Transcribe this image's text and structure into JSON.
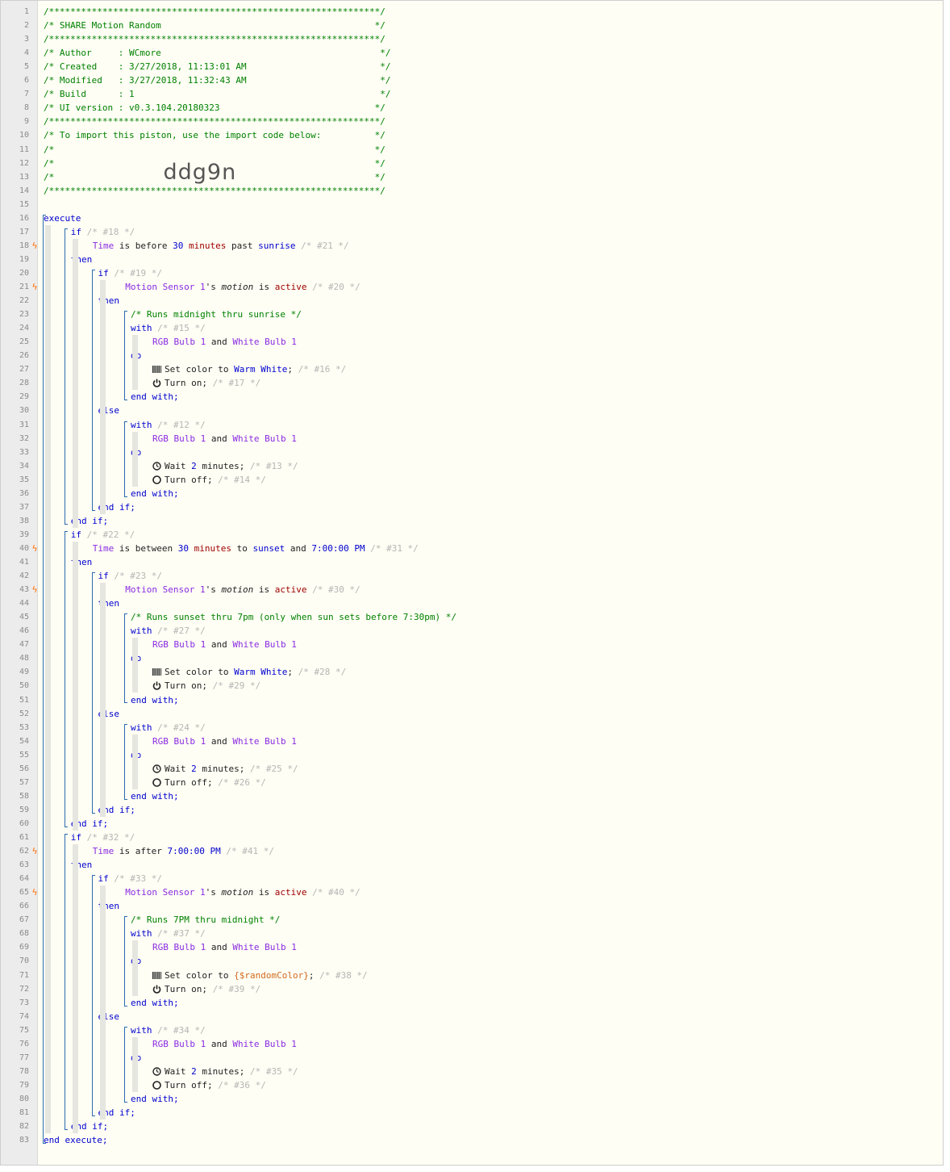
{
  "header": {
    "border_line": "/**************************************************************/",
    "share_line": "/* SHARE Motion Random                                        */",
    "author_line": "/* Author     : WCmore                                         */",
    "created_line": "/* Created    : 3/27/2018, 11:13:01 AM                         */",
    "modified_line": "/* Modified   : 3/27/2018, 11:32:43 AM                         */",
    "build_line": "/* Build      : 1                                              */",
    "ui_line": "/* UI version : v0.3.104.20180323                             */",
    "import_line": "/* To import this piston, use the import code below:          */",
    "blank_line": "/*                                                            */",
    "import_code": "ddg9n"
  },
  "code": {
    "execute": "execute",
    "end_execute": "end execute;",
    "if": "if",
    "then": "then",
    "else": "else",
    "end_if": "end if;",
    "with": "with",
    "do": "do",
    "end_with": "end with;",
    "and": "and",
    "time": "Time",
    "is_before": "is before",
    "past": "past",
    "sunrise": "sunrise",
    "is_between": "is between",
    "to": "to",
    "sunset": "sunset",
    "is_after": "is after",
    "minutes_30": "30",
    "minutes_unit": "minutes",
    "time_7pm": "7:00:00 PM",
    "motion_sensor": "Motion Sensor 1",
    "apos_s": "'s",
    "motion_attr": "motion",
    "is": "is",
    "active": "active",
    "rgb_bulb": "RGB Bulb 1",
    "white_bulb": "White Bulb 1",
    "set_color_to": "Set color to",
    "warm_white": "Warm White",
    "random_color": "{$randomColor}",
    "semicolon": ";",
    "turn_on": "Turn on;",
    "turn_off": "Turn off;",
    "wait": "Wait",
    "wait_num": "2",
    "wait_unit": "minutes;",
    "comment_midnight_sunrise": "/* Runs midnight thru sunrise */",
    "comment_sunset_7pm": "/* Runs sunset thru 7pm (only when sun sets before 7:30pm) */",
    "comment_7pm_midnight": "/* Runs 7PM thru midnight */"
  },
  "ids": {
    "id18": "/* #18 */",
    "id21": "/* #21 */",
    "id19": "/* #19 */",
    "id20": "/* #20 */",
    "id15": "/* #15 */",
    "id16": "/* #16 */",
    "id17": "/* #17 */",
    "id12": "/* #12 */",
    "id13": "/* #13 */",
    "id14": "/* #14 */",
    "id22": "/* #22 */",
    "id31": "/* #31 */",
    "id23": "/* #23 */",
    "id30": "/* #30 */",
    "id27": "/* #27 */",
    "id28": "/* #28 */",
    "id29": "/* #29 */",
    "id24": "/* #24 */",
    "id25": "/* #25 */",
    "id26": "/* #26 */",
    "id32": "/* #32 */",
    "id41": "/* #41 */",
    "id33": "/* #33 */",
    "id40": "/* #40 */",
    "id37": "/* #37 */",
    "id38": "/* #38 */",
    "id39": "/* #39 */",
    "id34": "/* #34 */",
    "id35": "/* #35 */",
    "id36": "/* #36 */"
  },
  "line_numbers": [
    "1",
    "2",
    "3",
    "4",
    "5",
    "6",
    "7",
    "8",
    "9",
    "10",
    "11",
    "12",
    "13",
    "14",
    "15",
    "16",
    "17",
    "18",
    "19",
    "20",
    "21",
    "22",
    "23",
    "24",
    "25",
    "26",
    "27",
    "28",
    "29",
    "30",
    "31",
    "32",
    "33",
    "34",
    "35",
    "36",
    "37",
    "38",
    "39",
    "40",
    "41",
    "42",
    "43",
    "44",
    "45",
    "46",
    "47",
    "48",
    "49",
    "50",
    "51",
    "52",
    "53",
    "54",
    "55",
    "56",
    "57",
    "58",
    "59",
    "60",
    "61",
    "62",
    "63",
    "64",
    "65",
    "66",
    "67",
    "68",
    "69",
    "70",
    "71",
    "72",
    "73",
    "74",
    "75",
    "76",
    "77",
    "78",
    "79",
    "80",
    "81",
    "82",
    "83"
  ],
  "bolt_glyph": "ϟ",
  "bolt_lines": [
    18,
    21,
    40,
    43,
    62,
    65
  ],
  "colors": {
    "comment": "#008000",
    "keyword": "#0000d0",
    "device": "#8a2be2",
    "value": "#a00000",
    "variable": "#d2691e",
    "bolt": "#ff6f00",
    "bar": "#2b6cb0"
  }
}
